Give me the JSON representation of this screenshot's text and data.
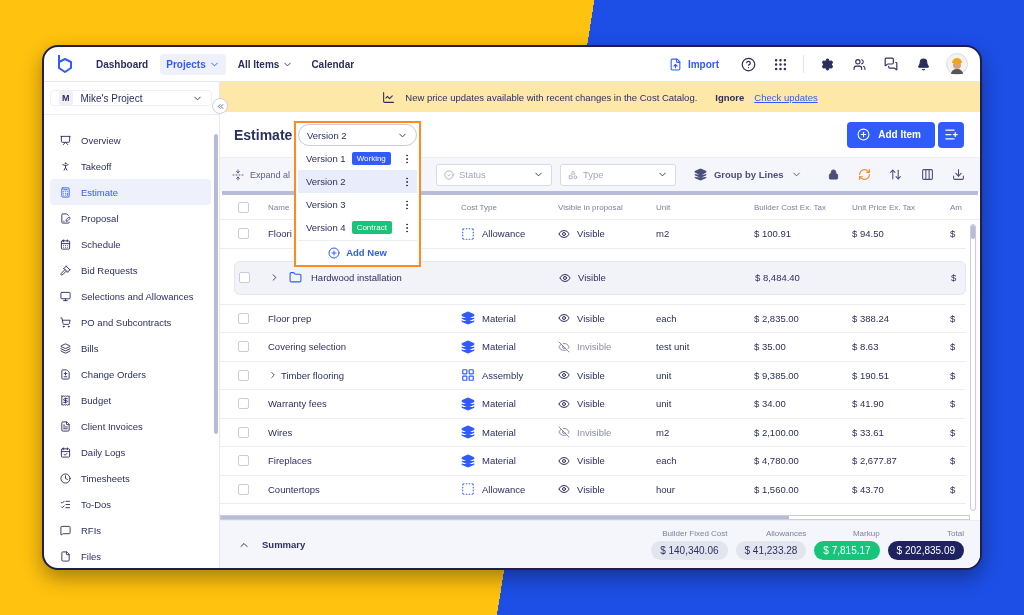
{
  "top_nav": {
    "items": [
      {
        "label": "Dashboard",
        "selected": false,
        "has_menu": false
      },
      {
        "label": "Projects",
        "selected": true,
        "has_menu": true
      },
      {
        "label": "All Items",
        "selected": false,
        "has_menu": true
      },
      {
        "label": "Calendar",
        "selected": false,
        "has_menu": false
      }
    ],
    "import_label": "Import"
  },
  "project": {
    "initial": "M",
    "name": "Mike's Project"
  },
  "sidebar": {
    "items": [
      {
        "label": "Overview",
        "selected": false
      },
      {
        "label": "Takeoff",
        "selected": false
      },
      {
        "label": "Estimate",
        "selected": true
      },
      {
        "label": "Proposal",
        "selected": false
      },
      {
        "label": "Schedule",
        "selected": false
      },
      {
        "label": "Bid Requests",
        "selected": false
      },
      {
        "label": "Selections and Allowances",
        "selected": false
      },
      {
        "label": "PO and Subcontracts",
        "selected": false
      },
      {
        "label": "Bills",
        "selected": false
      },
      {
        "label": "Change Orders",
        "selected": false
      },
      {
        "label": "Budget",
        "selected": false
      },
      {
        "label": "Client Invoices",
        "selected": false
      },
      {
        "label": "Daily Logs",
        "selected": false
      },
      {
        "label": "Timesheets",
        "selected": false
      },
      {
        "label": "To-Dos",
        "selected": false
      },
      {
        "label": "RFIs",
        "selected": false
      },
      {
        "label": "Files",
        "selected": false
      }
    ]
  },
  "banner": {
    "message": "New price updates available with recent changes in the Cost Catalog.",
    "ignore": "Ignore",
    "link": "Check updates"
  },
  "header": {
    "title": "Estimate",
    "add_item": "Add Item"
  },
  "version_menu": {
    "value": "Version 2",
    "options": [
      {
        "label": "Version 1",
        "selected": false,
        "badge": "Working",
        "color": "#2f5bff"
      },
      {
        "label": "Version 2",
        "selected": true
      },
      {
        "label": "Version 3",
        "selected": false
      },
      {
        "label": "Version 4",
        "selected": false,
        "badge": "Contract",
        "color": "#18c37a"
      }
    ],
    "add_new": "Add New"
  },
  "toolbar": {
    "expand": "Expand al",
    "status_placeholder": "Status",
    "type_placeholder": "Type",
    "group_by": "Group by Lines"
  },
  "table": {
    "all_checked": false,
    "columns": [
      "Name",
      "Cost Type",
      "Visible in proposal",
      "Unit",
      "Builder Cost Ex. Tax",
      "Unit Price Ex. Tax",
      "Am"
    ],
    "rows": [
      {
        "kind": "allowance",
        "checked": false,
        "name": "Floori",
        "cost_type": "Allowance",
        "visible": true,
        "visibility": "Visible",
        "unit": "m2",
        "builder_cost": "$ 100.91",
        "unit_price": "$ 94.50",
        "amount": "$"
      },
      {
        "kind": "group",
        "checked": false,
        "expanded": false,
        "name": "Hardwood installation",
        "visible": true,
        "visibility": "Visible",
        "builder_cost": "$ 8,484.40",
        "amount": "$"
      },
      {
        "kind": "material",
        "checked": false,
        "name": "Floor prep",
        "cost_type": "Material",
        "visible": true,
        "visibility": "Visible",
        "unit": "each",
        "builder_cost": "$ 2,835.00",
        "unit_price": "$ 388.24",
        "amount": "$"
      },
      {
        "kind": "material",
        "checked": false,
        "name": "Covering selection",
        "cost_type": "Material",
        "visible": false,
        "visibility": "Invisible",
        "unit": "test unit",
        "builder_cost": "$ 35.00",
        "unit_price": "$ 8.63",
        "amount": "$"
      },
      {
        "kind": "assembly",
        "checked": false,
        "expanded": false,
        "name": "Timber flooring",
        "cost_type": "Assembly",
        "visible": true,
        "visibility": "Visible",
        "unit": "unit",
        "builder_cost": "$ 9,385.00",
        "unit_price": "$ 190.51",
        "amount": "$"
      },
      {
        "kind": "material",
        "checked": false,
        "name": "Warranty fees",
        "cost_type": "Material",
        "visible": true,
        "visibility": "Visible",
        "unit": "unit",
        "builder_cost": "$ 34.00",
        "unit_price": "$ 41.90",
        "amount": "$"
      },
      {
        "kind": "material",
        "checked": false,
        "name": "Wires",
        "cost_type": "Material",
        "visible": false,
        "visibility": "Invisible",
        "unit": "m2",
        "builder_cost": "$ 2,100.00",
        "unit_price": "$ 33.61",
        "amount": "$"
      },
      {
        "kind": "material",
        "checked": false,
        "name": "Fireplaces",
        "cost_type": "Material",
        "visible": true,
        "visibility": "Visible",
        "unit": "each",
        "builder_cost": "$ 4,780.00",
        "unit_price": "$ 2,677.87",
        "amount": "$"
      },
      {
        "kind": "allowance",
        "checked": false,
        "name": "Countertops",
        "cost_type": "Allowance",
        "visible": true,
        "visibility": "Visible",
        "unit": "hour",
        "builder_cost": "$ 1,560.00",
        "unit_price": "$ 43.70",
        "amount": "$"
      }
    ]
  },
  "summary": {
    "title": "Summary",
    "totals": [
      {
        "label": "Builder Fixed Cost",
        "value": "$ 140,340.06",
        "color": "#e3e5ee"
      },
      {
        "label": "Allowances",
        "value": "$ 41,233.28",
        "color": "#e3e5ee"
      },
      {
        "label": "Markup",
        "value": "$ 7,815.17",
        "color": "#18c37a"
      },
      {
        "label": "Total",
        "value": "$ 202,835.09",
        "color": "#1f2260"
      }
    ]
  }
}
